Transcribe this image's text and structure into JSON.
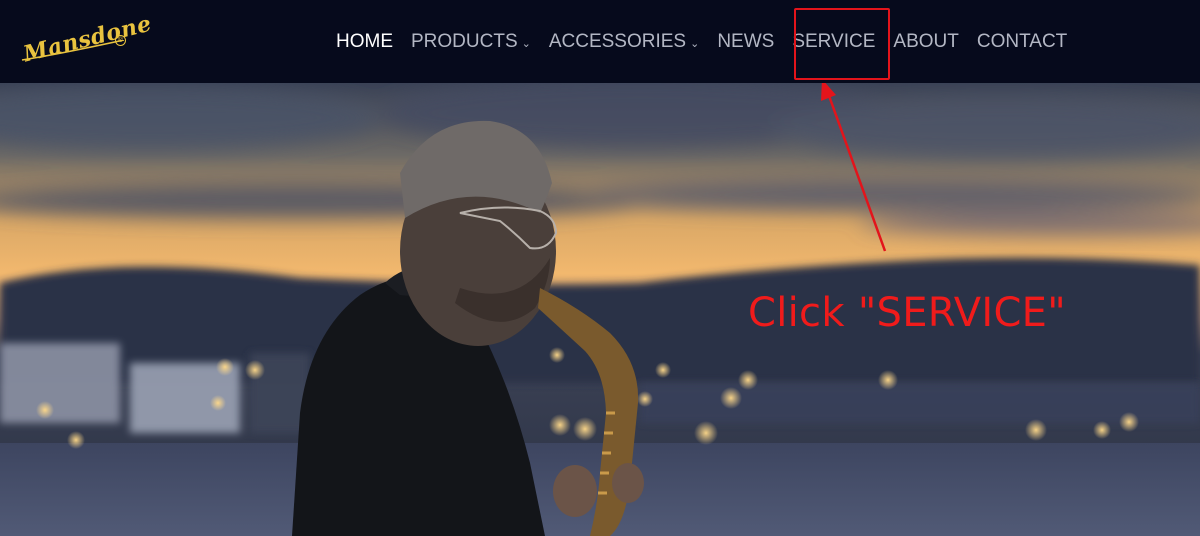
{
  "logo": {
    "text": "Mansdone",
    "registered_mark": "®"
  },
  "nav": {
    "items": [
      {
        "label": "HOME",
        "active": true,
        "has_dropdown": false
      },
      {
        "label": "PRODUCTS",
        "active": false,
        "has_dropdown": true
      },
      {
        "label": "ACCESSORIES",
        "active": false,
        "has_dropdown": true
      },
      {
        "label": "NEWS",
        "active": false,
        "has_dropdown": false
      },
      {
        "label": "SERVICE",
        "active": false,
        "has_dropdown": false
      },
      {
        "label": "ABOUT",
        "active": false,
        "has_dropdown": false
      },
      {
        "label": "CONTACT",
        "active": false,
        "has_dropdown": false
      }
    ],
    "dropdown_icon": "chevron-down-icon"
  },
  "hero": {
    "image": "saxophone player at dusk by harbor"
  },
  "annotation": {
    "instruction": "Click \"SERVICE\"",
    "color": "#f01b1b"
  },
  "colors": {
    "header_bg": "#060a1c",
    "logo_gold": "#e9c33f",
    "nav_text": "#b3b7c4",
    "nav_active": "#ffffff",
    "highlight_red": "#e3141b"
  }
}
